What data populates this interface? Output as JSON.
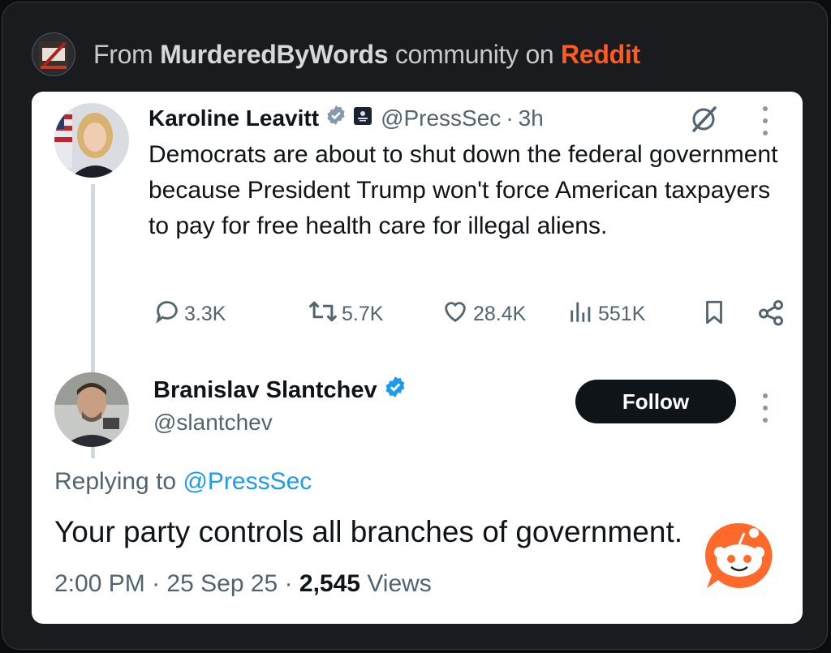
{
  "header": {
    "prefix": "From",
    "community": "MurderedByWords",
    "middle": "community on",
    "platform": "Reddit"
  },
  "tweet1": {
    "name": "Karoline Leavitt",
    "handle": "@PressSec",
    "sep": "·",
    "time": "3h",
    "text": "Democrats are about to shut down the federal government because President Trump won't force American taxpayers to pay for free health care for illegal aliens.",
    "replies": "3.3K",
    "retweets": "5.7K",
    "likes": "28.4K",
    "views": "551K"
  },
  "tweet2": {
    "name": "Branislav Slantchev",
    "handle": "@slantchev",
    "follow_label": "Follow",
    "replying_prefix": "Replying to",
    "replying_to": "@PressSec",
    "text": "Your party controls all branches of government.",
    "time": "2:00 PM",
    "date": "25 Sep 25",
    "sep": "·",
    "views_count": "2,545",
    "views_label": "Views"
  },
  "colors": {
    "reddit_orange": "#ff5a1f",
    "verified_blue": "#1d9bf0",
    "verified_gray": "#829aab",
    "follow_bg": "#0f1419"
  },
  "icons": [
    "reply-icon",
    "retweet-icon",
    "like-icon",
    "views-icon",
    "bookmark-icon",
    "share-icon",
    "grok-icon",
    "more-icon",
    "verified-badge-icon",
    "reddit-snoo-icon"
  ]
}
